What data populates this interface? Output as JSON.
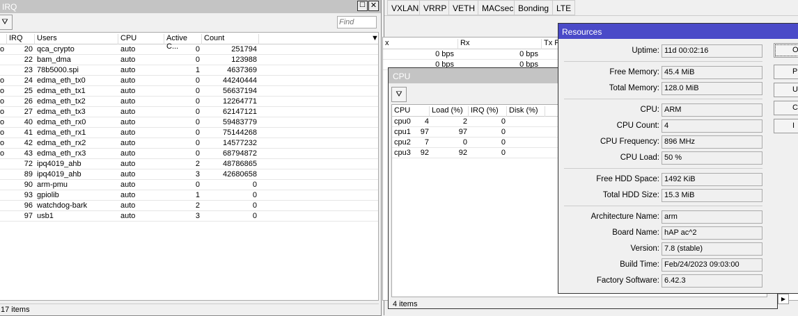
{
  "irq": {
    "title": "IRQ",
    "find_placeholder": "Find",
    "columns": [
      "IRQ",
      "Users",
      "CPU",
      "Active C...",
      "Count"
    ],
    "rows": [
      {
        "flag": "o",
        "irq": "20",
        "users": "qca_crypto",
        "cpu": "auto",
        "active": "0",
        "count": "251794"
      },
      {
        "flag": "",
        "irq": "22",
        "users": "bam_dma",
        "cpu": "auto",
        "active": "0",
        "count": "123988"
      },
      {
        "flag": "",
        "irq": "23",
        "users": "78b5000.spi",
        "cpu": "auto",
        "active": "1",
        "count": "4637369"
      },
      {
        "flag": "o",
        "irq": "24",
        "users": "edma_eth_tx0",
        "cpu": "auto",
        "active": "0",
        "count": "44240444"
      },
      {
        "flag": "o",
        "irq": "25",
        "users": "edma_eth_tx1",
        "cpu": "auto",
        "active": "0",
        "count": "56637194"
      },
      {
        "flag": "o",
        "irq": "26",
        "users": "edma_eth_tx2",
        "cpu": "auto",
        "active": "0",
        "count": "12264771"
      },
      {
        "flag": "o",
        "irq": "27",
        "users": "edma_eth_tx3",
        "cpu": "auto",
        "active": "0",
        "count": "62147121"
      },
      {
        "flag": "o",
        "irq": "40",
        "users": "edma_eth_rx0",
        "cpu": "auto",
        "active": "0",
        "count": "59483779"
      },
      {
        "flag": "o",
        "irq": "41",
        "users": "edma_eth_rx1",
        "cpu": "auto",
        "active": "0",
        "count": "75144268"
      },
      {
        "flag": "o",
        "irq": "42",
        "users": "edma_eth_rx2",
        "cpu": "auto",
        "active": "0",
        "count": "14577232"
      },
      {
        "flag": "o",
        "irq": "43",
        "users": "edma_eth_rx3",
        "cpu": "auto",
        "active": "0",
        "count": "68794872"
      },
      {
        "flag": "",
        "irq": "72",
        "users": "ipq4019_ahb",
        "cpu": "auto",
        "active": "2",
        "count": "48786865"
      },
      {
        "flag": "",
        "irq": "89",
        "users": "ipq4019_ahb",
        "cpu": "auto",
        "active": "3",
        "count": "42680658"
      },
      {
        "flag": "",
        "irq": "90",
        "users": "arm-pmu",
        "cpu": "auto",
        "active": "0",
        "count": "0"
      },
      {
        "flag": "",
        "irq": "93",
        "users": "gpiolib",
        "cpu": "auto",
        "active": "1",
        "count": "0"
      },
      {
        "flag": "",
        "irq": "96",
        "users": "watchdog-bark",
        "cpu": "auto",
        "active": "2",
        "count": "0"
      },
      {
        "flag": "",
        "irq": "97",
        "users": "usb1",
        "cpu": "auto",
        "active": "3",
        "count": "0"
      }
    ],
    "footer": "17 items"
  },
  "interfaces": {
    "tabs": [
      "VXLAN",
      "VRRP",
      "VETH",
      "MACsec",
      "Bonding",
      "LTE"
    ],
    "columns": [
      "x",
      "Rx",
      "Tx P"
    ],
    "rows": [
      [
        "0 bps",
        "0 bps"
      ],
      [
        "0 bps",
        "0 bps"
      ]
    ]
  },
  "cpu": {
    "title": "CPU",
    "columns": [
      "CPU",
      "Load (%)",
      "IRQ (%)",
      "Disk (%)"
    ],
    "rows": [
      [
        "cpu0",
        "4",
        "2",
        "0"
      ],
      [
        "cpu1",
        "97",
        "97",
        "0"
      ],
      [
        "cpu2",
        "7",
        "0",
        "0"
      ],
      [
        "cpu3",
        "92",
        "92",
        "0"
      ]
    ],
    "footer": "4 items"
  },
  "resources": {
    "title": "Resources",
    "accent": "#4a4ac8",
    "fields": [
      {
        "label": "Uptime:",
        "value": "11d 00:02:16"
      },
      {
        "label": "Free Memory:",
        "value": "45.4 MiB"
      },
      {
        "label": "Total Memory:",
        "value": "128.0 MiB"
      },
      {
        "label": "CPU:",
        "value": "ARM"
      },
      {
        "label": "CPU Count:",
        "value": "4"
      },
      {
        "label": "CPU Frequency:",
        "value": "896 MHz"
      },
      {
        "label": "CPU Load:",
        "value": "50 %"
      },
      {
        "label": "Free HDD Space:",
        "value": "1492 KiB"
      },
      {
        "label": "Total HDD Size:",
        "value": "15.3 MiB"
      },
      {
        "label": "Architecture Name:",
        "value": "arm"
      },
      {
        "label": "Board Name:",
        "value": "hAP ac^2"
      },
      {
        "label": "Version:",
        "value": "7.8 (stable)"
      },
      {
        "label": "Build Time:",
        "value": "Feb/24/2023 09:03:00"
      },
      {
        "label": "Factory Software:",
        "value": "6.42.3"
      }
    ],
    "buttons": [
      "O",
      "P",
      "U",
      "C",
      "I"
    ]
  }
}
